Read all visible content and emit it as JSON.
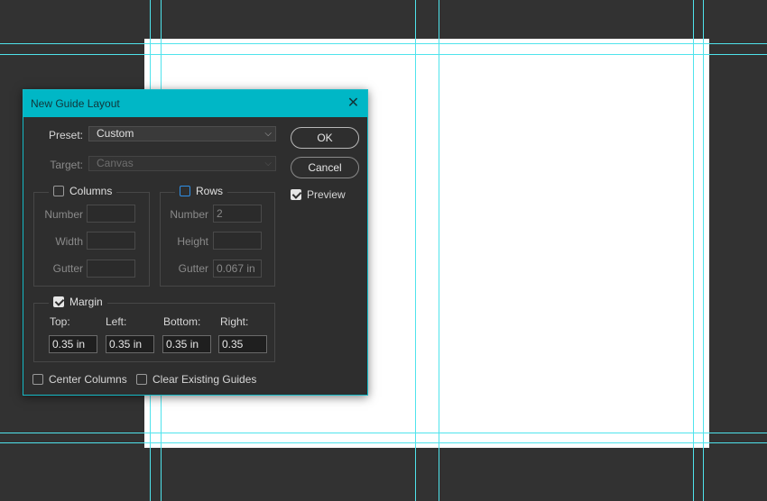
{
  "dialog": {
    "title": "New Guide Layout",
    "close_icon": "close-icon"
  },
  "preset": {
    "label": "Preset:",
    "value": "Custom"
  },
  "target": {
    "label": "Target:",
    "value": "Canvas"
  },
  "columns": {
    "label": "Columns",
    "checked": false,
    "number_label": "Number",
    "width_label": "Width",
    "gutter_label": "Gutter",
    "number": "",
    "width": "",
    "gutter": ""
  },
  "rows": {
    "label": "Rows",
    "checked": false,
    "number_label": "Number",
    "height_label": "Height",
    "gutter_label": "Gutter",
    "number": "2",
    "height": "",
    "gutter": "0.067 in"
  },
  "margin": {
    "label": "Margin",
    "checked": true,
    "top_label": "Top:",
    "left_label": "Left:",
    "bottom_label": "Bottom:",
    "right_label": "Right:",
    "top": "0.35 in",
    "left": "0.35 in",
    "bottom": "0.35 in",
    "right": "0.35"
  },
  "options": {
    "center_columns": {
      "label": "Center Columns",
      "checked": false
    },
    "clear_existing": {
      "label": "Clear Existing Guides",
      "checked": false
    }
  },
  "buttons": {
    "ok": "OK",
    "cancel": "Cancel"
  },
  "preview": {
    "label": "Preview",
    "checked": true
  },
  "colors": {
    "workspace": "#323232",
    "titlebar": "#00b7c6",
    "guide": "#4fe3ec"
  }
}
